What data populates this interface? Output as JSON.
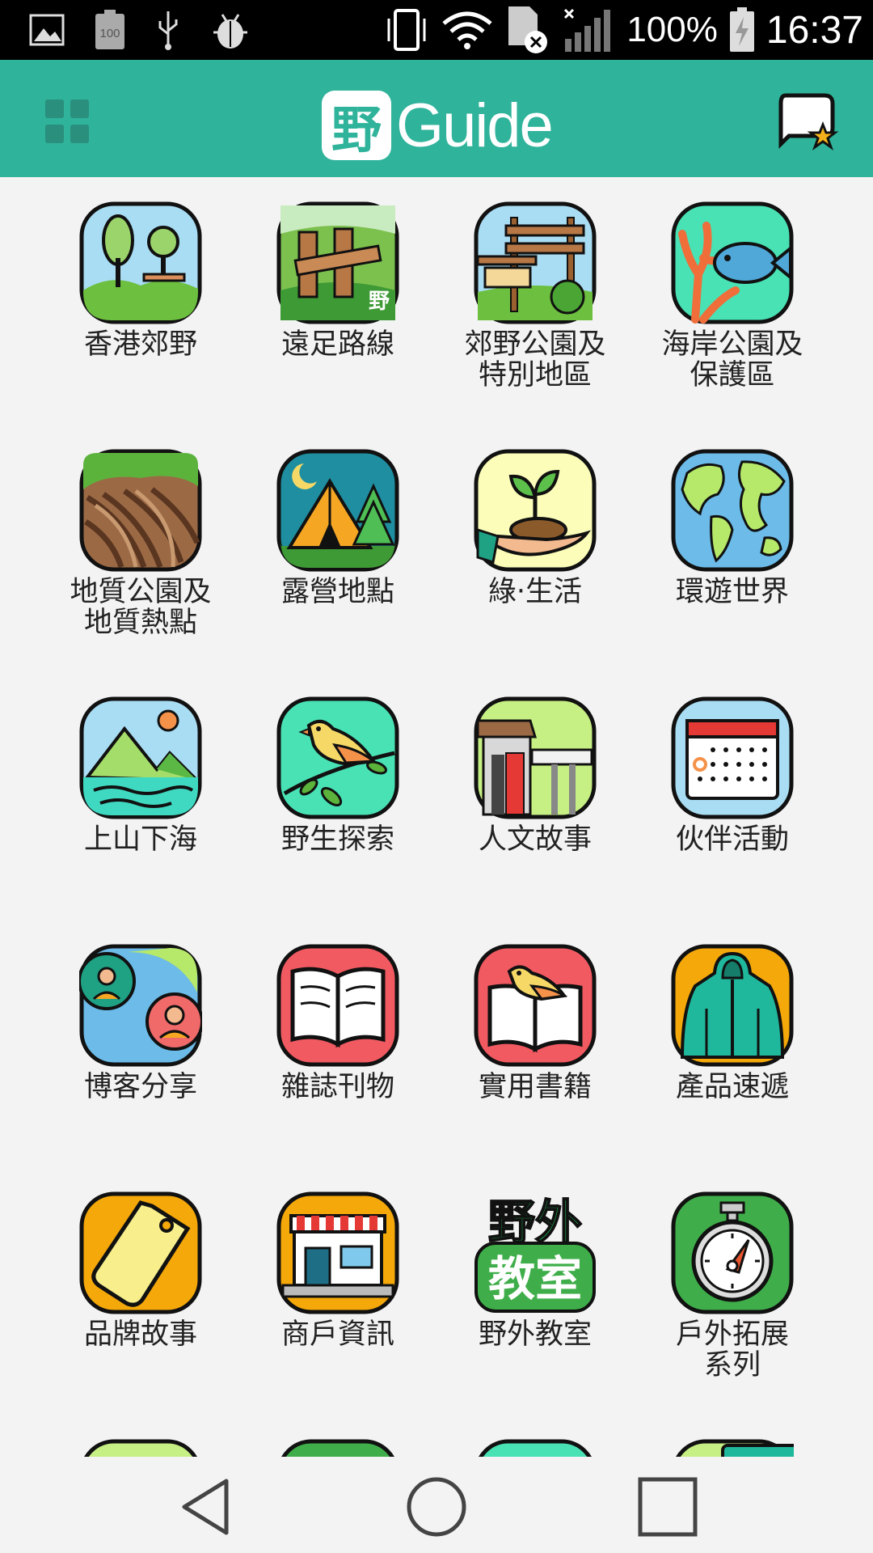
{
  "status_bar": {
    "battery_percent": "100%",
    "time": "16:37",
    "battery_icon_label": "100",
    "icons": [
      "gallery-icon",
      "battery-saver-icon",
      "usb-icon",
      "debug-icon",
      "vibrate-icon",
      "wifi-icon",
      "sim-disabled-icon",
      "signal-icon",
      "battery-charging-icon"
    ]
  },
  "header": {
    "logo_char": "野",
    "logo_word": "Guide",
    "menu_icon": "grid-menu-icon",
    "fav_icon": "favorites-chat-star-icon",
    "background": "#2fb39b"
  },
  "grid": {
    "items": [
      {
        "label": "香港郊野",
        "icon": "country-park-icon"
      },
      {
        "label": "遠足路線",
        "icon": "hiking-trail-sign-icon"
      },
      {
        "label": "郊野公園及\n特別地區",
        "icon": "park-bench-icon"
      },
      {
        "label": "海岸公園及\n保護區",
        "icon": "marine-fish-coral-icon"
      },
      {
        "label": "地質公園及\n地質熱點",
        "icon": "geopark-rock-icon"
      },
      {
        "label": "露營地點",
        "icon": "camping-tent-icon"
      },
      {
        "label": "綠‧生活",
        "icon": "sprout-hand-icon"
      },
      {
        "label": "環遊世界",
        "icon": "globe-icon"
      },
      {
        "label": "上山下海",
        "icon": "mountain-sea-icon"
      },
      {
        "label": "野生探索",
        "icon": "wild-bird-icon"
      },
      {
        "label": "人文故事",
        "icon": "heritage-building-icon"
      },
      {
        "label": "伙伴活動",
        "icon": "calendar-icon"
      },
      {
        "label": "博客分享",
        "icon": "blogger-share-icon"
      },
      {
        "label": "雜誌刊物",
        "icon": "magazine-book-icon"
      },
      {
        "label": "實用書籍",
        "icon": "practical-book-bird-icon"
      },
      {
        "label": "產品速遞",
        "icon": "jacket-product-icon"
      },
      {
        "label": "品牌故事",
        "icon": "brand-tag-icon"
      },
      {
        "label": "商戶資訊",
        "icon": "shop-store-icon"
      },
      {
        "label": "野外教室",
        "icon": "outdoor-classroom-icon",
        "badge_lines": [
          "野外",
          "教室"
        ]
      },
      {
        "label": "戶外拓展\n系列",
        "icon": "stopwatch-icon"
      }
    ]
  },
  "nav_bar": {
    "icons": [
      "back-icon",
      "home-icon",
      "recents-icon"
    ]
  }
}
